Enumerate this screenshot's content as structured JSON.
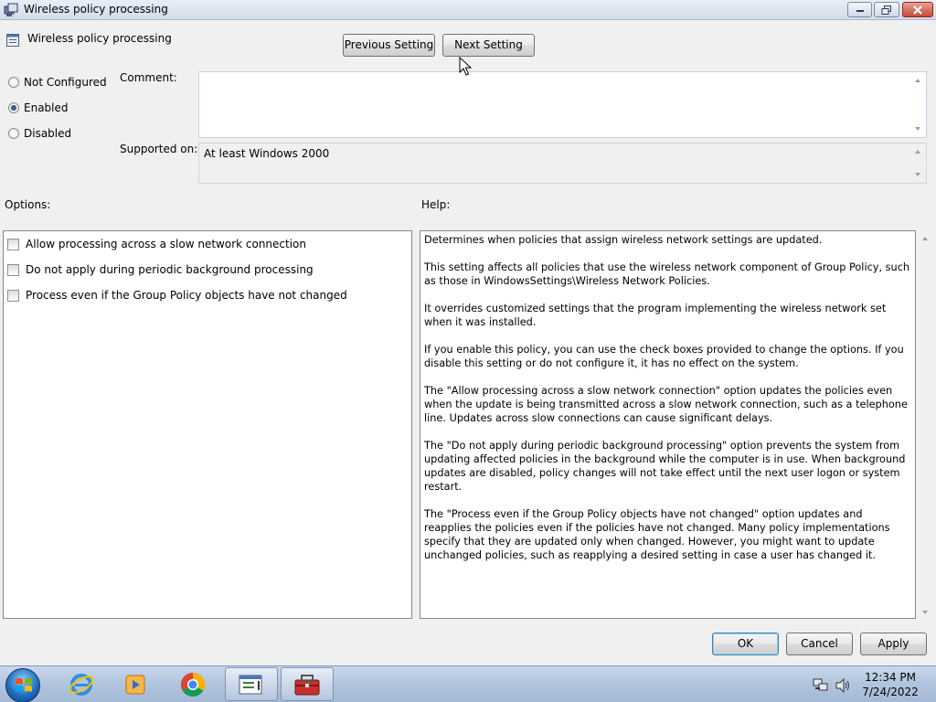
{
  "window": {
    "title": "Wireless policy processing"
  },
  "header": {
    "policy_name": "Wireless policy processing",
    "previous_label": "Previous Setting",
    "next_label": "Next Setting"
  },
  "state": {
    "options": [
      {
        "label": "Not Configured",
        "selected": false
      },
      {
        "label": "Enabled",
        "selected": true
      },
      {
        "label": "Disabled",
        "selected": false
      }
    ]
  },
  "comment": {
    "label": "Comment:",
    "value": ""
  },
  "supported": {
    "label": "Supported on:",
    "value": "At least Windows 2000"
  },
  "options_panel": {
    "label": "Options:",
    "checkboxes": [
      {
        "label": "Allow processing across a slow network connection",
        "checked": false
      },
      {
        "label": "Do not apply during periodic background processing",
        "checked": false
      },
      {
        "label": "Process even if the Group Policy objects have not changed",
        "checked": false
      }
    ]
  },
  "help_panel": {
    "label": "Help:",
    "paragraphs": [
      "Determines when policies that assign wireless network settings are updated.",
      "This setting affects all policies that use the wireless network component of Group Policy, such as those in WindowsSettings\\Wireless Network Policies.",
      "It overrides customized settings that the program implementing the wireless network set when it was installed.",
      "If you enable this policy, you can use the check boxes provided to change the options. If you disable this setting or do not configure it, it has no effect on the system.",
      "The \"Allow processing across a slow network connection\" option updates the policies even when the update is being transmitted across a slow network connection, such as a telephone line. Updates across slow connections can cause significant delays.",
      "The \"Do not apply during periodic background processing\" option prevents the system from updating affected policies in the background while the computer is in use. When background updates are disabled, policy changes will not take effect until the next user logon or system restart.",
      "The \"Process even if the Group Policy objects have not changed\" option updates and reapplies the policies even if the policies have not changed. Many policy implementations specify that they are updated only when changed. However, you might want to update unchanged policies, such as reapplying a desired setting in case a user has changed it."
    ]
  },
  "footer": {
    "ok_label": "OK",
    "cancel_label": "Cancel",
    "apply_label": "Apply"
  },
  "taskbar": {
    "items": [
      {
        "name": "internet-explorer-icon"
      },
      {
        "name": "media-player-icon"
      },
      {
        "name": "chrome-icon"
      },
      {
        "name": "policy-editor-icon",
        "active": true
      },
      {
        "name": "toolbox-icon",
        "active": true
      }
    ],
    "tray": {
      "time": "12:34 PM",
      "date": "7/24/2022"
    }
  },
  "colors": {
    "titlebar": "#dbe4f1",
    "taskbar": "#b3c6df",
    "panel_border": "#828790",
    "ok_focus": "#3c7fb1"
  }
}
